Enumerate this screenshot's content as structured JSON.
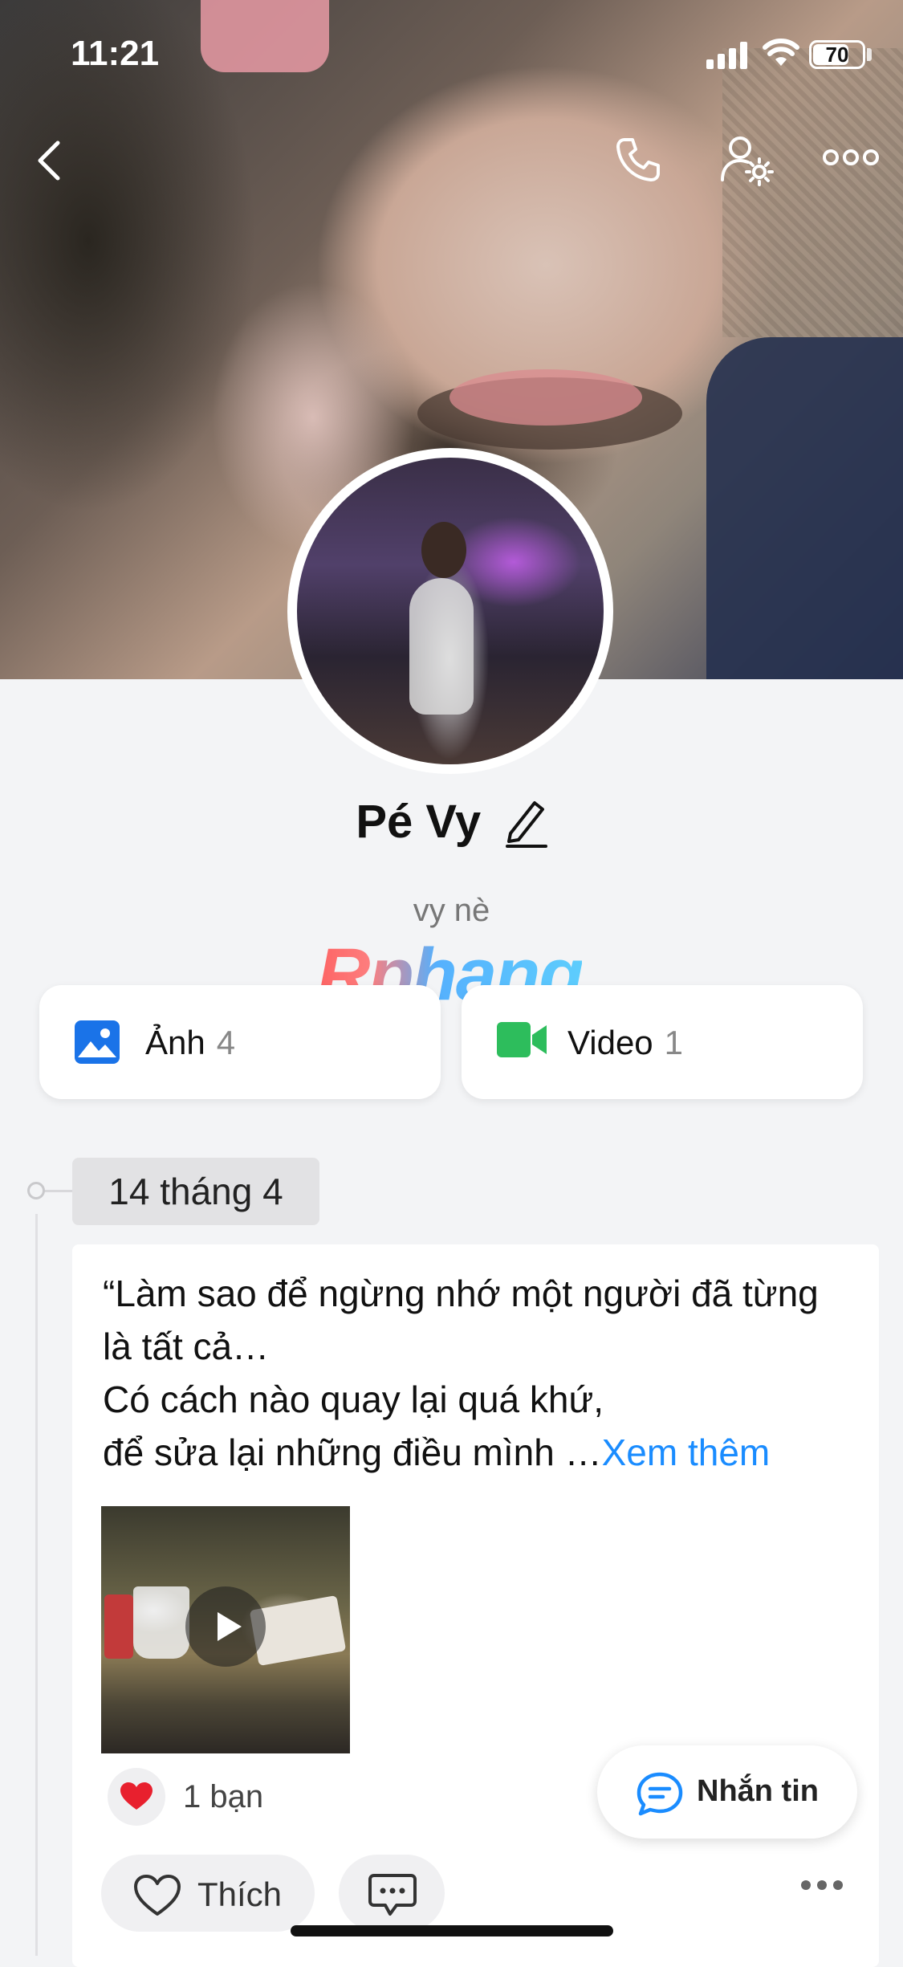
{
  "status_bar": {
    "time": "11:21",
    "battery": "70"
  },
  "nav": {
    "back_icon": "chevron-left-icon",
    "call_icon": "phone-icon",
    "settings_icon": "user-gear-icon",
    "more_icon": "more-horizontal-icon"
  },
  "profile": {
    "name": "Pé Vy",
    "bio": "vy nè"
  },
  "watermark": "Rphang",
  "media": {
    "photos": {
      "label": "Ảnh",
      "count": "4",
      "icon": "image-icon",
      "color": "#1a73e8"
    },
    "videos": {
      "label": "Video",
      "count": "1",
      "icon": "video-camera-icon",
      "color": "#2dbd5c"
    }
  },
  "timeline": {
    "date": "14 tháng 4"
  },
  "post": {
    "lines": [
      "“Làm sao để ngừng nhớ một người đã từng",
      "là tất cả…",
      "Có cách nào quay lại quá khứ,",
      "để sửa lại những điều mình …"
    ],
    "see_more": "Xem thêm",
    "reactions_text": "1 bạn",
    "like_label": "Thích",
    "accent": "#1a8cff"
  },
  "message_button": {
    "label": "Nhắn tin"
  }
}
